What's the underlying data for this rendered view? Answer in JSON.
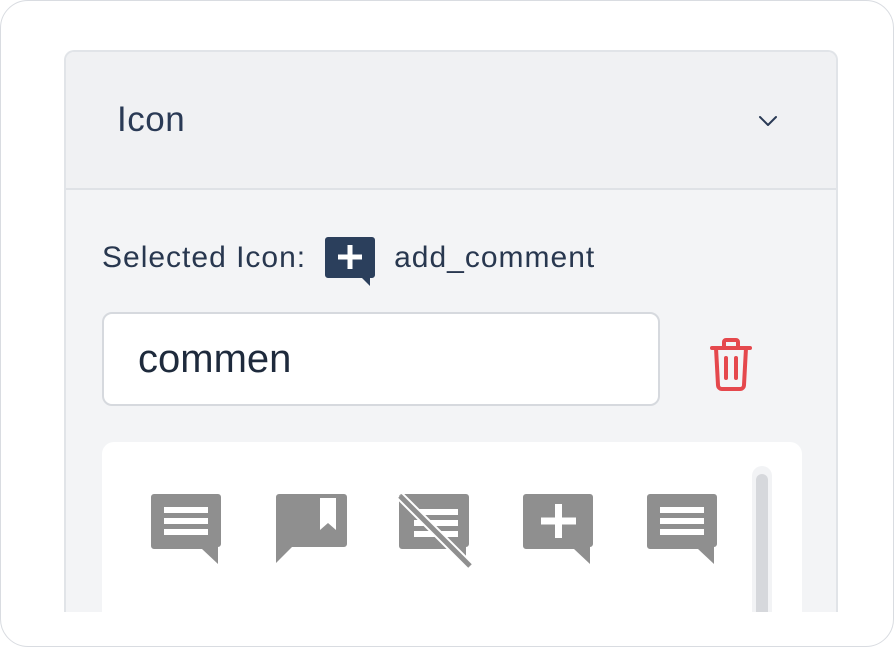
{
  "panel": {
    "title": "Icon",
    "chevron_icon": "chevron-down-icon"
  },
  "selected": {
    "label": "Selected Icon:",
    "icon_name": "add_comment",
    "icon": "add-comment-icon",
    "icon_color": "#2b3f5c"
  },
  "search": {
    "value": "commen",
    "placeholder": ""
  },
  "delete": {
    "icon": "trash-icon",
    "color": "#e5484d"
  },
  "results": {
    "icon_color": "#8f8f8f",
    "icons": [
      "comment-icon",
      "comment-bank-icon",
      "comments-disabled-icon",
      "add-comment-icon",
      "chat-icon"
    ]
  }
}
